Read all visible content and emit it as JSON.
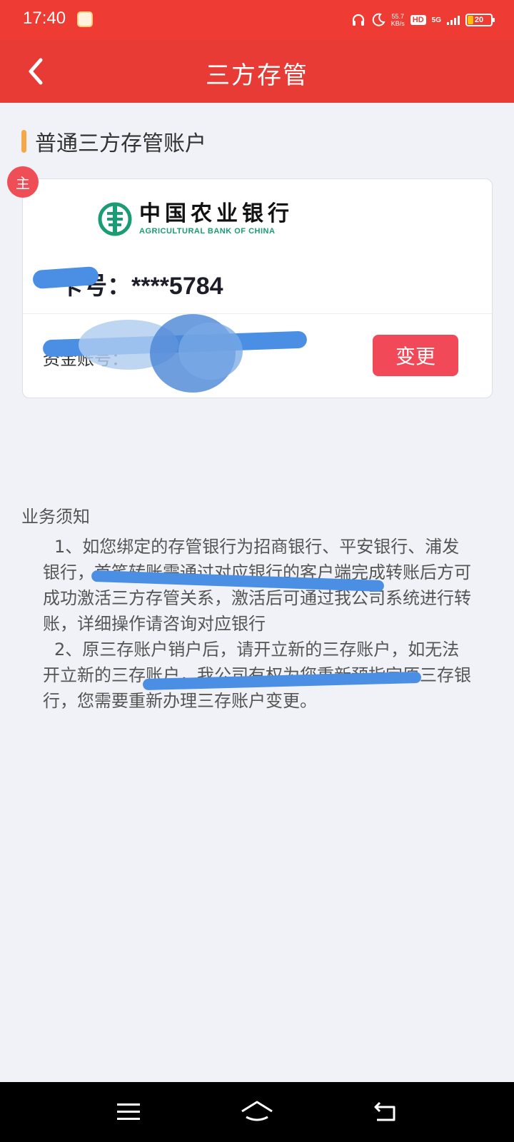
{
  "status_bar": {
    "time": "17:40",
    "net_speed_value": "55.7",
    "net_speed_unit": "KB/s",
    "hd_label": "HD",
    "network_label": "5G",
    "battery_level": "20"
  },
  "header": {
    "title": "三方存管"
  },
  "section": {
    "title": "普通三方存管账户"
  },
  "card": {
    "primary_badge": "主",
    "bank_name_cn": "中国农业银行",
    "bank_name_en": "AGRICULTURAL BANK OF CHINA",
    "card_number": "卡号：****5784",
    "fund_account_label": "资金账号：",
    "change_button": "变更"
  },
  "notice": {
    "title": "业务须知",
    "item1": "1、如您绑定的存管银行为招商银行、平安银行、浦发银行，首笔转账需通过对应银行的客户端完成转账后方可成功激活三方存管关系，激活后可通过我公司系统进行转账，详细操作请咨询对应银行",
    "item2": "2、原三存账户销户后，请开立新的三存账户，如无法开立新的三存账户，我公司有权为您重新预指定原三存银行，您需要重新办理三存账户变更。"
  },
  "colors": {
    "header_red": "#e83b35",
    "accent_orange": "#f5a849",
    "button_red": "#f14958",
    "abc_green": "#1a9c74",
    "redaction_blue": "#4a8fe3"
  },
  "icons": {
    "back": "chevron-left-icon",
    "menu": "menu-icon",
    "home": "home-icon",
    "back_nav": "return-icon"
  }
}
